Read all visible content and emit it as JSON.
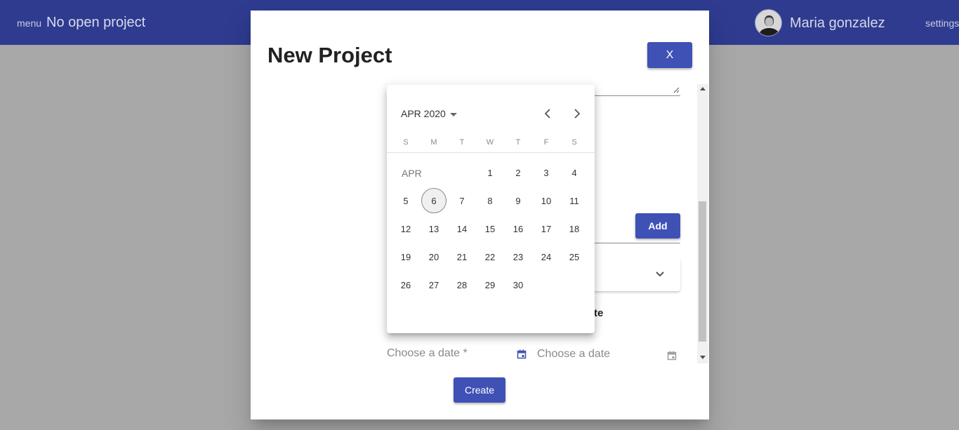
{
  "toolbar": {
    "menu_label": "menu",
    "project_title": "No open project",
    "user_name": "Maria gonzalez",
    "settings_label": "settings"
  },
  "modal": {
    "title": "New Project",
    "close_label": "X",
    "add_label": "Add",
    "label_fragment": "te",
    "start_date_placeholder": "Choose a date *",
    "end_date_placeholder": "Choose a date",
    "create_label": "Create"
  },
  "datepicker": {
    "period_label": "APR 2020",
    "weekdays": [
      "S",
      "M",
      "T",
      "W",
      "T",
      "F",
      "S"
    ],
    "month_label": "APR",
    "first_weekday_index": 3,
    "days_in_month": 30,
    "today": 6
  },
  "colors": {
    "primary": "#3f51b5",
    "toolbar": "#2e3b8f",
    "overlay": "#a8a8a8"
  }
}
